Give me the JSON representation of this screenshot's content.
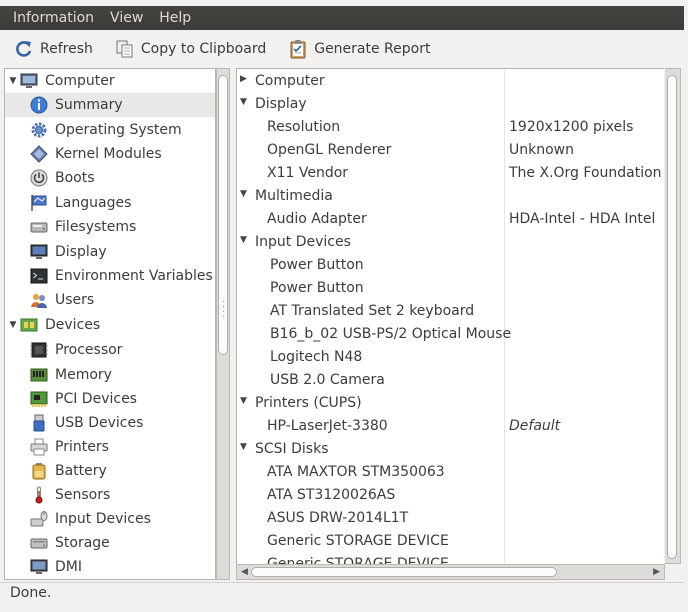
{
  "menubar": {
    "items": [
      "Information",
      "View",
      "Help"
    ]
  },
  "toolbar": {
    "refresh_label": "Refresh",
    "copy_label": "Copy to Clipboard",
    "report_label": "Generate Report"
  },
  "tree": {
    "computer_label": "Computer",
    "computer_items": [
      "Summary",
      "Operating System",
      "Kernel Modules",
      "Boots",
      "Languages",
      "Filesystems",
      "Display",
      "Environment Variables",
      "Users"
    ],
    "devices_label": "Devices",
    "devices_items": [
      "Processor",
      "Memory",
      "PCI Devices",
      "USB Devices",
      "Printers",
      "Battery",
      "Sensors",
      "Input Devices",
      "Storage",
      "DMI"
    ]
  },
  "details": {
    "rows": [
      {
        "key": "Computer",
        "value": ""
      },
      {
        "key": "Display",
        "value": ""
      },
      {
        "key": "Resolution",
        "value": "1920x1200 pixels"
      },
      {
        "key": "OpenGL Renderer",
        "value": "Unknown"
      },
      {
        "key": "X11 Vendor",
        "value": "The X.Org Foundation"
      },
      {
        "key": "Multimedia",
        "value": ""
      },
      {
        "key": "Audio Adapter",
        "value": "HDA-Intel - HDA Intel"
      },
      {
        "key": "Input Devices",
        "value": ""
      },
      {
        "key": "Power Button",
        "value": ""
      },
      {
        "key": "Power Button",
        "value": ""
      },
      {
        "key": "AT Translated Set 2 keyboard",
        "value": ""
      },
      {
        "key": "B16_b_02 USB-PS/2 Optical Mouse",
        "value": ""
      },
      {
        "key": "Logitech N48",
        "value": ""
      },
      {
        "key": "USB 2.0 Camera",
        "value": ""
      },
      {
        "key": "Printers (CUPS)",
        "value": ""
      },
      {
        "key": "HP-LaserJet-3380",
        "value": "Default"
      },
      {
        "key": "SCSI Disks",
        "value": ""
      },
      {
        "key": "ATA MAXTOR STM350063",
        "value": ""
      },
      {
        "key": "ATA ST3120026AS",
        "value": ""
      },
      {
        "key": "ASUS DRW-2014L1T",
        "value": ""
      },
      {
        "key": "Generic STORAGE DEVICE",
        "value": ""
      },
      {
        "key": "Generic STORAGE DEVICE",
        "value": ""
      }
    ]
  },
  "status": {
    "text": "Done."
  }
}
